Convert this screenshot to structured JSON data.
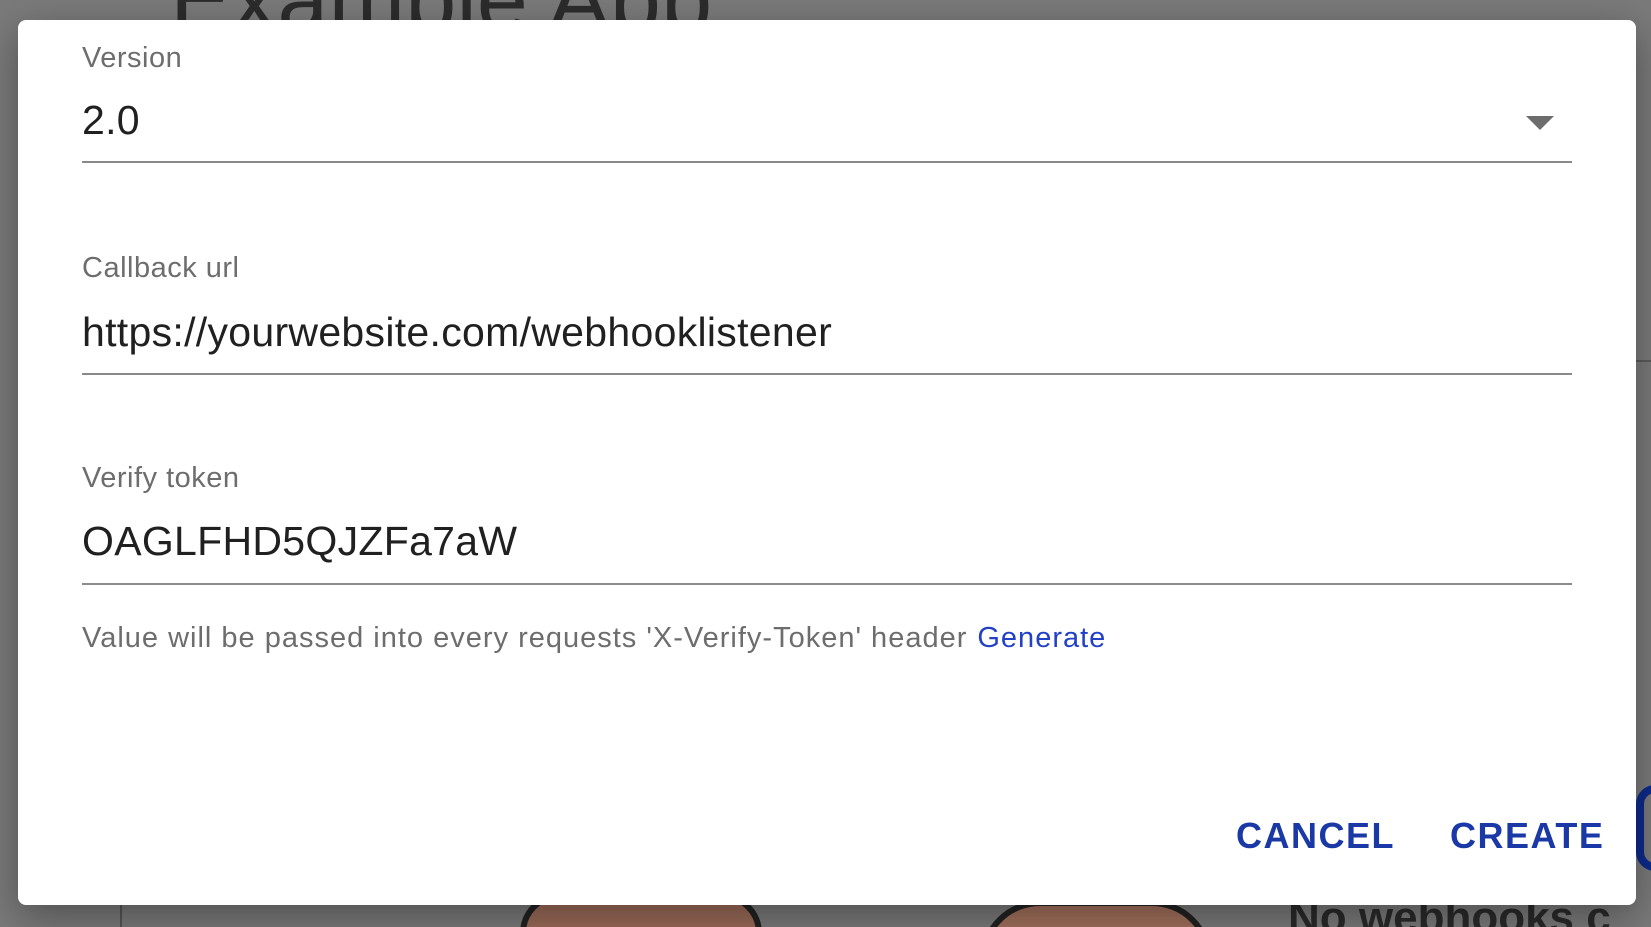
{
  "background": {
    "app_title": "Example App",
    "empty_state_text": "No webhooks c"
  },
  "dialog": {
    "fields": {
      "version": {
        "label": "Version",
        "value": "2.0"
      },
      "callback_url": {
        "label": "Callback url",
        "value": "https://yourwebsite.com/webhooklistener"
      },
      "verify_token": {
        "label": "Verify token",
        "value": "OAGLFHD5QJZFa7aW",
        "helper_text": "Value will be passed into every requests 'X-Verify-Token' header",
        "helper_link": "Generate"
      }
    },
    "actions": {
      "cancel_label": "CANCEL",
      "create_label": "CREATE"
    }
  },
  "colors": {
    "accent": "#1a38a6",
    "link": "#2341c6",
    "overlay": "#7a7a7a"
  }
}
